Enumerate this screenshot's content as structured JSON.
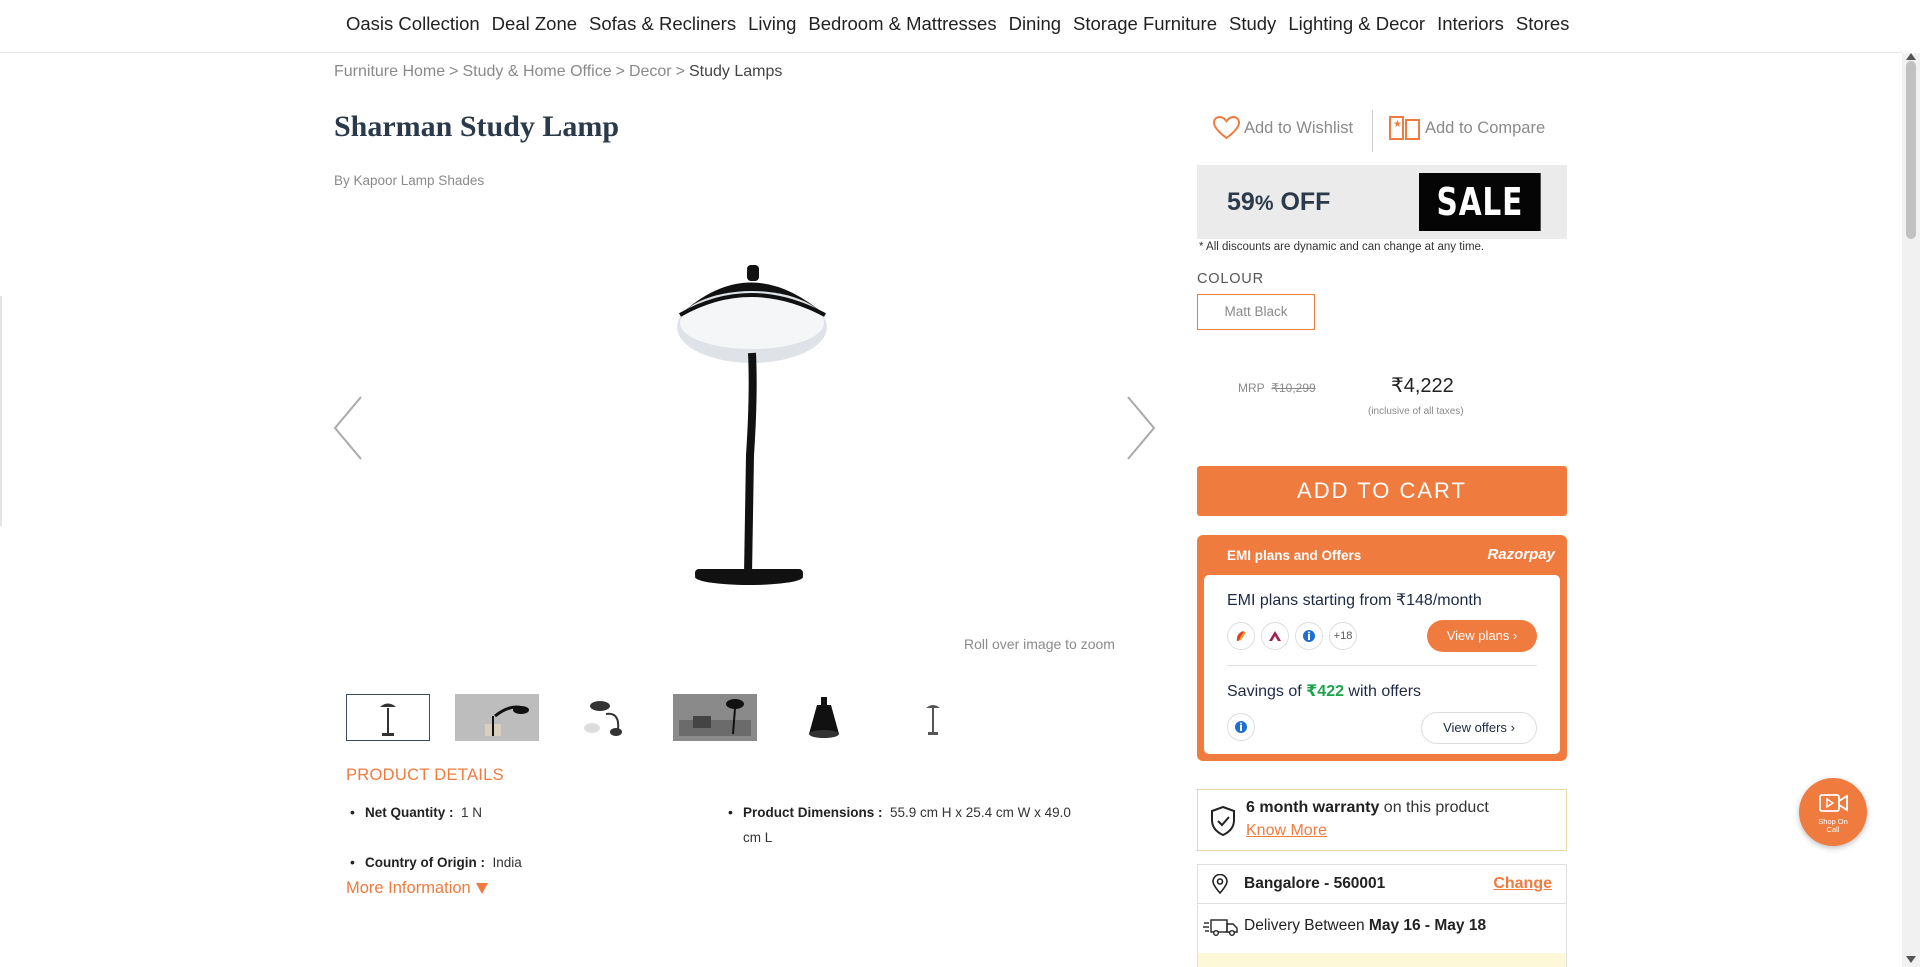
{
  "nav": {
    "items": [
      "Oasis Collection",
      "Deal Zone",
      "Sofas & Recliners",
      "Living",
      "Bedroom & Mattresses",
      "Dining",
      "Storage Furniture",
      "Study",
      "Lighting & Decor",
      "Interiors",
      "Stores"
    ]
  },
  "breadcrumb": {
    "items": [
      "Furniture Home",
      "Study & Home Office",
      "Decor"
    ],
    "separator": ">",
    "current": "Study Lamps"
  },
  "product": {
    "title": "Sharman Study Lamp",
    "brand": "By Kapoor Lamp Shades",
    "zoom_hint": "Roll over image to zoom",
    "thumbnails_count": 6,
    "selected_thumbnail": 1
  },
  "details": {
    "heading": "PRODUCT DETAILS",
    "net_quantity_label": "Net Quantity :",
    "net_quantity_value": "1 N",
    "dimensions_label": "Product Dimensions :",
    "dimensions_value": "55.9 cm H x 25.4 cm W x 49.0 cm L",
    "origin_label": "Country of Origin :",
    "origin_value": "India",
    "more_info": "More Information"
  },
  "actions": {
    "wishlist": "Add to Wishlist",
    "compare": "Add to Compare"
  },
  "sale": {
    "discount_number": "59",
    "discount_symbol": "%",
    "discount_word": " OFF",
    "tag": "SALE",
    "disclaimer": "* All discounts are dynamic and can change at any time."
  },
  "colour": {
    "label": "COLOUR",
    "selected": "Matt Black"
  },
  "pricing": {
    "mrp_label": "MRP",
    "mrp_value": "₹10,299",
    "price": "₹4,222",
    "tax_note": "(inclusive of all taxes)"
  },
  "cart": {
    "label": "ADD TO CART"
  },
  "emi": {
    "header": "EMI plans and Offers",
    "provider": "Razorpay",
    "plans_text": "EMI plans starting from ₹148/month",
    "more_banks": "+18",
    "view_plans": "View plans",
    "savings_prefix": "Savings of ",
    "savings_amount": "₹422",
    "savings_suffix": " with offers",
    "view_offers": "View offers"
  },
  "warranty": {
    "bold": "6 month warranty",
    "rest": " on this product",
    "link": "Know More"
  },
  "location": {
    "city": "Bangalore - 560001",
    "change": "Change"
  },
  "delivery": {
    "prefix": "Delivery Between ",
    "dates": "May 16 - May 18"
  },
  "shop_on_call": {
    "label_line1": "Shop On",
    "label_line2": "Call"
  },
  "colors": {
    "accent": "#f07b3f",
    "title": "#2b3a4a",
    "savings_green": "#19a64a"
  }
}
